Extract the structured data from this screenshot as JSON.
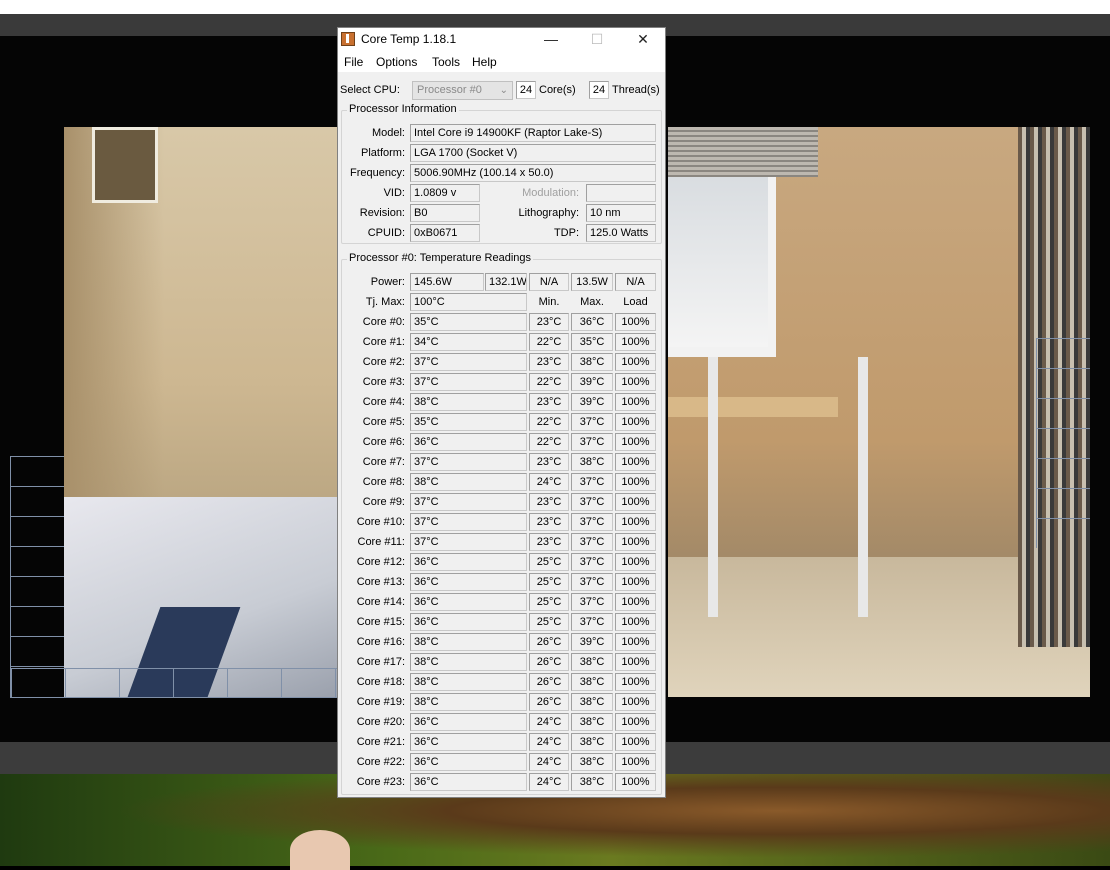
{
  "window": {
    "title": "Core Temp 1.18.1",
    "buttons": {
      "minimize": "—",
      "maximize": "☐",
      "close": "✕"
    }
  },
  "menu": [
    "File",
    "Options",
    "Tools",
    "Help"
  ],
  "select_cpu": {
    "label": "Select CPU:",
    "value": "Processor #0",
    "cores_value": "24",
    "cores_label": "Core(s)",
    "threads_value": "24",
    "threads_label": "Thread(s)"
  },
  "processor_info": {
    "title": "Processor Information",
    "model_label": "Model:",
    "model": "Intel Core i9 14900KF (Raptor Lake-S)",
    "platform_label": "Platform:",
    "platform": "LGA 1700 (Socket V)",
    "frequency_label": "Frequency:",
    "frequency": "5006.90MHz (100.14 x 50.0)",
    "vid_label": "VID:",
    "vid": "1.0809 v",
    "modulation_label": "Modulation:",
    "modulation": "",
    "revision_label": "Revision:",
    "revision": "B0",
    "lithography_label": "Lithography:",
    "lithography": "10 nm",
    "cpuid_label": "CPUID:",
    "cpuid": "0xB0671",
    "tdp_label": "TDP:",
    "tdp": "125.0 Watts"
  },
  "readings": {
    "title": "Processor #0: Temperature Readings",
    "power_label": "Power:",
    "power": [
      "145.6W",
      "132.1W",
      "N/A",
      "13.5W",
      "N/A"
    ],
    "tjmax_label": "Tj. Max:",
    "tjmax": "100°C",
    "col_min": "Min.",
    "col_max": "Max.",
    "col_load": "Load",
    "cores": [
      {
        "label": "Core #0:",
        "temp": "35°C",
        "min": "23°C",
        "max": "36°C",
        "load": "100%"
      },
      {
        "label": "Core #1:",
        "temp": "34°C",
        "min": "22°C",
        "max": "35°C",
        "load": "100%"
      },
      {
        "label": "Core #2:",
        "temp": "37°C",
        "min": "23°C",
        "max": "38°C",
        "load": "100%"
      },
      {
        "label": "Core #3:",
        "temp": "37°C",
        "min": "22°C",
        "max": "39°C",
        "load": "100%"
      },
      {
        "label": "Core #4:",
        "temp": "38°C",
        "min": "23°C",
        "max": "39°C",
        "load": "100%"
      },
      {
        "label": "Core #5:",
        "temp": "35°C",
        "min": "22°C",
        "max": "37°C",
        "load": "100%"
      },
      {
        "label": "Core #6:",
        "temp": "36°C",
        "min": "22°C",
        "max": "37°C",
        "load": "100%"
      },
      {
        "label": "Core #7:",
        "temp": "37°C",
        "min": "23°C",
        "max": "38°C",
        "load": "100%"
      },
      {
        "label": "Core #8:",
        "temp": "38°C",
        "min": "24°C",
        "max": "37°C",
        "load": "100%"
      },
      {
        "label": "Core #9:",
        "temp": "37°C",
        "min": "23°C",
        "max": "37°C",
        "load": "100%"
      },
      {
        "label": "Core #10:",
        "temp": "37°C",
        "min": "23°C",
        "max": "37°C",
        "load": "100%"
      },
      {
        "label": "Core #11:",
        "temp": "37°C",
        "min": "23°C",
        "max": "37°C",
        "load": "100%"
      },
      {
        "label": "Core #12:",
        "temp": "36°C",
        "min": "25°C",
        "max": "37°C",
        "load": "100%"
      },
      {
        "label": "Core #13:",
        "temp": "36°C",
        "min": "25°C",
        "max": "37°C",
        "load": "100%"
      },
      {
        "label": "Core #14:",
        "temp": "36°C",
        "min": "25°C",
        "max": "37°C",
        "load": "100%"
      },
      {
        "label": "Core #15:",
        "temp": "36°C",
        "min": "25°C",
        "max": "37°C",
        "load": "100%"
      },
      {
        "label": "Core #16:",
        "temp": "38°C",
        "min": "26°C",
        "max": "39°C",
        "load": "100%"
      },
      {
        "label": "Core #17:",
        "temp": "38°C",
        "min": "26°C",
        "max": "38°C",
        "load": "100%"
      },
      {
        "label": "Core #18:",
        "temp": "38°C",
        "min": "26°C",
        "max": "38°C",
        "load": "100%"
      },
      {
        "label": "Core #19:",
        "temp": "38°C",
        "min": "26°C",
        "max": "38°C",
        "load": "100%"
      },
      {
        "label": "Core #20:",
        "temp": "36°C",
        "min": "24°C",
        "max": "38°C",
        "load": "100%"
      },
      {
        "label": "Core #21:",
        "temp": "36°C",
        "min": "24°C",
        "max": "38°C",
        "load": "100%"
      },
      {
        "label": "Core #22:",
        "temp": "36°C",
        "min": "24°C",
        "max": "38°C",
        "load": "100%"
      },
      {
        "label": "Core #23:",
        "temp": "36°C",
        "min": "24°C",
        "max": "38°C",
        "load": "100%"
      }
    ]
  }
}
